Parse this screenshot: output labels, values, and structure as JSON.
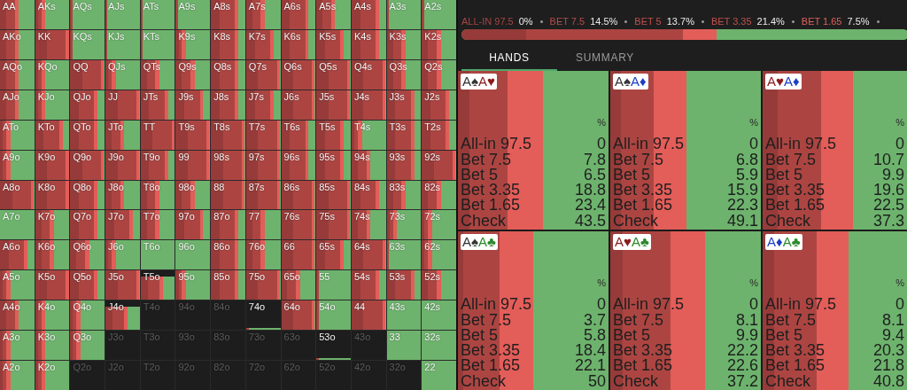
{
  "grid": {
    "rows": [
      {
        "cells": [
          {
            "hand": "AA",
            "kind": "mixed"
          },
          {
            "hand": "AKs",
            "kind": "light"
          },
          {
            "hand": "AQs",
            "kind": "trace"
          },
          {
            "hand": "AJs",
            "kind": "trace"
          },
          {
            "hand": "ATs",
            "kind": "trace"
          },
          {
            "hand": "A9s",
            "kind": "trace"
          },
          {
            "hand": "A8s",
            "kind": "heavy"
          },
          {
            "hand": "A7s",
            "kind": "mixed"
          },
          {
            "hand": "A6s",
            "kind": "heavy"
          },
          {
            "hand": "A5s",
            "kind": "mixed"
          },
          {
            "hand": "A4s",
            "kind": "heavy"
          },
          {
            "hand": "A3s",
            "kind": "trace"
          },
          {
            "hand": "A2s",
            "kind": "trace"
          }
        ]
      },
      {
        "cells": [
          {
            "hand": "AKo",
            "kind": "mixed"
          },
          {
            "hand": "KK",
            "kind": "full"
          },
          {
            "hand": "KQs",
            "kind": "trace"
          },
          {
            "hand": "KJs",
            "kind": "trace"
          },
          {
            "hand": "KTs",
            "kind": "trace"
          },
          {
            "hand": "K9s",
            "kind": "light"
          },
          {
            "hand": "K8s",
            "kind": "heavy"
          },
          {
            "hand": "K7s",
            "kind": "heavy"
          },
          {
            "hand": "K6s",
            "kind": "heavy"
          },
          {
            "hand": "K5s",
            "kind": "heavy"
          },
          {
            "hand": "K4s",
            "kind": "heavy"
          },
          {
            "hand": "K3s",
            "kind": "mixed"
          },
          {
            "hand": "K2s",
            "kind": "mixed"
          }
        ]
      },
      {
        "cells": [
          {
            "hand": "AQo",
            "kind": "mixed"
          },
          {
            "hand": "KQo",
            "kind": "light"
          },
          {
            "hand": "QQ",
            "kind": "full"
          },
          {
            "hand": "QJs",
            "kind": "light"
          },
          {
            "hand": "QTs",
            "kind": "mixed"
          },
          {
            "hand": "Q9s",
            "kind": "mixed"
          },
          {
            "hand": "Q8s",
            "kind": "heavy"
          },
          {
            "hand": "Q7s",
            "kind": "full"
          },
          {
            "hand": "Q6s",
            "kind": "full"
          },
          {
            "hand": "Q5s",
            "kind": "full"
          },
          {
            "hand": "Q4s",
            "kind": "full"
          },
          {
            "hand": "Q3s",
            "kind": "mixed"
          },
          {
            "hand": "Q2s",
            "kind": "mixed"
          }
        ]
      },
      {
        "cells": [
          {
            "hand": "AJo",
            "kind": "mixed"
          },
          {
            "hand": "KJo",
            "kind": "light"
          },
          {
            "hand": "QJo",
            "kind": "heavy"
          },
          {
            "hand": "JJ",
            "kind": "full"
          },
          {
            "hand": "JTs",
            "kind": "heavy"
          },
          {
            "hand": "J9s",
            "kind": "heavy"
          },
          {
            "hand": "J8s",
            "kind": "heavy"
          },
          {
            "hand": "J7s",
            "kind": "heavy"
          },
          {
            "hand": "J6s",
            "kind": "full"
          },
          {
            "hand": "J5s",
            "kind": "full"
          },
          {
            "hand": "J4s",
            "kind": "full"
          },
          {
            "hand": "J3s",
            "kind": "heavy"
          },
          {
            "hand": "J2s",
            "kind": "heavy"
          }
        ]
      },
      {
        "cells": [
          {
            "hand": "ATo",
            "kind": "light"
          },
          {
            "hand": "KTo",
            "kind": "heavy"
          },
          {
            "hand": "QTo",
            "kind": "heavy"
          },
          {
            "hand": "JTo",
            "kind": "mixed"
          },
          {
            "hand": "TT",
            "kind": "full"
          },
          {
            "hand": "T9s",
            "kind": "full"
          },
          {
            "hand": "T8s",
            "kind": "full"
          },
          {
            "hand": "T7s",
            "kind": "full"
          },
          {
            "hand": "T6s",
            "kind": "heavy"
          },
          {
            "hand": "T5s",
            "kind": "heavy"
          },
          {
            "hand": "T4s",
            "kind": "light"
          },
          {
            "hand": "T3s",
            "kind": "heavy"
          },
          {
            "hand": "T2s",
            "kind": "heavy"
          }
        ]
      },
      {
        "cells": [
          {
            "hand": "A9o",
            "kind": "light"
          },
          {
            "hand": "K9o",
            "kind": "full"
          },
          {
            "hand": "Q9o",
            "kind": "full"
          },
          {
            "hand": "J9o",
            "kind": "full"
          },
          {
            "hand": "T9o",
            "kind": "heavy"
          },
          {
            "hand": "99",
            "kind": "full"
          },
          {
            "hand": "98s",
            "kind": "full"
          },
          {
            "hand": "97s",
            "kind": "full"
          },
          {
            "hand": "96s",
            "kind": "heavy"
          },
          {
            "hand": "95s",
            "kind": "heavy"
          },
          {
            "hand": "94s",
            "kind": "mixed"
          },
          {
            "hand": "93s",
            "kind": "heavy"
          },
          {
            "hand": "92s",
            "kind": "full"
          }
        ]
      },
      {
        "cells": [
          {
            "hand": "A8o",
            "kind": "full"
          },
          {
            "hand": "K8o",
            "kind": "full"
          },
          {
            "hand": "Q8o",
            "kind": "heavy"
          },
          {
            "hand": "J8o",
            "kind": "mixed"
          },
          {
            "hand": "T8o",
            "kind": "mixed"
          },
          {
            "hand": "98o",
            "kind": "mixed"
          },
          {
            "hand": "88",
            "kind": "full"
          },
          {
            "hand": "87s",
            "kind": "full"
          },
          {
            "hand": "86s",
            "kind": "full"
          },
          {
            "hand": "85s",
            "kind": "full"
          },
          {
            "hand": "84s",
            "kind": "heavy"
          },
          {
            "hand": "83s",
            "kind": "mixed"
          },
          {
            "hand": "82s",
            "kind": "mixed"
          }
        ]
      },
      {
        "cells": [
          {
            "hand": "A7o",
            "kind": "check"
          },
          {
            "hand": "K7o",
            "kind": "mixed"
          },
          {
            "hand": "Q7o",
            "kind": "heavy"
          },
          {
            "hand": "J7o",
            "kind": "heavy"
          },
          {
            "hand": "T7o",
            "kind": "mixed"
          },
          {
            "hand": "97o",
            "kind": "heavy"
          },
          {
            "hand": "87o",
            "kind": "heavy"
          },
          {
            "hand": "77",
            "kind": "mixed"
          },
          {
            "hand": "76s",
            "kind": "full"
          },
          {
            "hand": "75s",
            "kind": "full"
          },
          {
            "hand": "74s",
            "kind": "mixed"
          },
          {
            "hand": "73s",
            "kind": "light"
          },
          {
            "hand": "72s",
            "kind": "light"
          }
        ]
      },
      {
        "cells": [
          {
            "hand": "A6o",
            "kind": "heavy"
          },
          {
            "hand": "K6o",
            "kind": "mixed"
          },
          {
            "hand": "Q6o",
            "kind": "mixed"
          },
          {
            "hand": "J6o",
            "kind": "light"
          },
          {
            "hand": "T6o",
            "kind": "check"
          },
          {
            "hand": "96o",
            "kind": "check"
          },
          {
            "hand": "86o",
            "kind": "heavy"
          },
          {
            "hand": "76o",
            "kind": "mixed"
          },
          {
            "hand": "66",
            "kind": "full"
          },
          {
            "hand": "65s",
            "kind": "heavy"
          },
          {
            "hand": "64s",
            "kind": "full"
          },
          {
            "hand": "63s",
            "kind": "trace"
          },
          {
            "hand": "62s",
            "kind": "light"
          }
        ]
      },
      {
        "cells": [
          {
            "hand": "A5o",
            "kind": "light"
          },
          {
            "hand": "K5o",
            "kind": "full"
          },
          {
            "hand": "Q5o",
            "kind": "heavy"
          },
          {
            "hand": "J5o",
            "kind": "full"
          },
          {
            "hand": "T5o",
            "kind": "partial"
          },
          {
            "hand": "95o",
            "kind": "light"
          },
          {
            "hand": "85o",
            "kind": "heavy"
          },
          {
            "hand": "75o",
            "kind": "full"
          },
          {
            "hand": "65o",
            "kind": "mixed"
          },
          {
            "hand": "55",
            "kind": "trace"
          },
          {
            "hand": "54s",
            "kind": "heavy"
          },
          {
            "hand": "53s",
            "kind": "heavy"
          },
          {
            "hand": "52s",
            "kind": "mixed"
          }
        ]
      },
      {
        "cells": [
          {
            "hand": "A4o",
            "kind": "mixed"
          },
          {
            "hand": "K4o",
            "kind": "light"
          },
          {
            "hand": "Q4o",
            "kind": "light"
          },
          {
            "hand": "J4o",
            "kind": "partial"
          },
          {
            "hand": "T4o",
            "kind": "empty"
          },
          {
            "hand": "94o",
            "kind": "empty"
          },
          {
            "hand": "84o",
            "kind": "empty"
          },
          {
            "hand": "74o",
            "kind": "sliver"
          },
          {
            "hand": "64o",
            "kind": "full"
          },
          {
            "hand": "54o",
            "kind": "trace"
          },
          {
            "hand": "44",
            "kind": "full"
          },
          {
            "hand": "43s",
            "kind": "check"
          },
          {
            "hand": "42s",
            "kind": "check"
          }
        ]
      },
      {
        "cells": [
          {
            "hand": "A3o",
            "kind": "light"
          },
          {
            "hand": "K3o",
            "kind": "light"
          },
          {
            "hand": "Q3o",
            "kind": "light"
          },
          {
            "hand": "J3o",
            "kind": "empty"
          },
          {
            "hand": "T3o",
            "kind": "empty"
          },
          {
            "hand": "93o",
            "kind": "empty"
          },
          {
            "hand": "83o",
            "kind": "empty"
          },
          {
            "hand": "73o",
            "kind": "empty"
          },
          {
            "hand": "63o",
            "kind": "empty"
          },
          {
            "hand": "53o",
            "kind": "sliver"
          },
          {
            "hand": "43o",
            "kind": "empty"
          },
          {
            "hand": "33",
            "kind": "check"
          },
          {
            "hand": "32s",
            "kind": "check"
          }
        ]
      },
      {
        "cells": [
          {
            "hand": "A2o",
            "kind": "light"
          },
          {
            "hand": "K2o",
            "kind": "light"
          },
          {
            "hand": "Q2o",
            "kind": "empty"
          },
          {
            "hand": "J2o",
            "kind": "empty"
          },
          {
            "hand": "T2o",
            "kind": "empty"
          },
          {
            "hand": "92o",
            "kind": "empty"
          },
          {
            "hand": "82o",
            "kind": "empty"
          },
          {
            "hand": "72o",
            "kind": "empty"
          },
          {
            "hand": "62o",
            "kind": "empty"
          },
          {
            "hand": "52o",
            "kind": "empty"
          },
          {
            "hand": "42o",
            "kind": "empty"
          },
          {
            "hand": "32o",
            "kind": "empty"
          },
          {
            "hand": "22",
            "kind": "check"
          }
        ]
      }
    ]
  },
  "legend": [
    {
      "label": "ALL-IN 97.5",
      "value": "0%",
      "color": "#a84444"
    },
    {
      "label": "BET 7.5",
      "value": "14.5%",
      "color": "#b84c4a"
    },
    {
      "label": "BET 5",
      "value": "13.7%",
      "color": "#c0504d"
    },
    {
      "label": "BET 3.35",
      "value": "21.4%",
      "color": "#c0504d"
    },
    {
      "label": "BET 1.65",
      "value": "7.5%",
      "color": "#e0605b"
    }
  ],
  "tabs": [
    {
      "label": "HANDS",
      "selected": true
    },
    {
      "label": "SUMMARY",
      "selected": false
    }
  ],
  "hands": [
    {
      "cards": [
        {
          "rank": "A",
          "suit": "♠",
          "color": "#333333"
        },
        {
          "rank": "A",
          "suit": "♥",
          "color": "#8b1a1a"
        }
      ],
      "unit": "%",
      "rows": [
        {
          "label": "All-in 97.5",
          "value": "0"
        },
        {
          "label": "Bet 7.5",
          "value": "7.8"
        },
        {
          "label": "Bet 5",
          "value": "6.5"
        },
        {
          "label": "Bet 3.35",
          "value": "18.8"
        },
        {
          "label": "Bet 1.65",
          "value": "23.4"
        },
        {
          "label": "Check",
          "value": "43.5"
        }
      ]
    },
    {
      "cards": [
        {
          "rank": "A",
          "suit": "♠",
          "color": "#333333"
        },
        {
          "rank": "A",
          "suit": "♦",
          "color": "#1d3fc4"
        }
      ],
      "unit": "%",
      "rows": [
        {
          "label": "All-in 97.5",
          "value": "0"
        },
        {
          "label": "Bet 7.5",
          "value": "6.8"
        },
        {
          "label": "Bet 5",
          "value": "5.9"
        },
        {
          "label": "Bet 3.35",
          "value": "15.9"
        },
        {
          "label": "Bet 1.65",
          "value": "22.3"
        },
        {
          "label": "Check",
          "value": "49.1"
        }
      ]
    },
    {
      "cards": [
        {
          "rank": "A",
          "suit": "♥",
          "color": "#8b1a1a"
        },
        {
          "rank": "A",
          "suit": "♦",
          "color": "#1d3fc4"
        }
      ],
      "unit": "%",
      "rows": [
        {
          "label": "All-in 97.5",
          "value": "0"
        },
        {
          "label": "Bet 7.5",
          "value": "10.7"
        },
        {
          "label": "Bet 5",
          "value": "9.9"
        },
        {
          "label": "Bet 3.35",
          "value": "19.6"
        },
        {
          "label": "Bet 1.65",
          "value": "22.5"
        },
        {
          "label": "Check",
          "value": "37.3"
        }
      ]
    },
    {
      "cards": [
        {
          "rank": "A",
          "suit": "♠",
          "color": "#333333"
        },
        {
          "rank": "A",
          "suit": "♣",
          "color": "#2c8a2c"
        }
      ],
      "unit": "%",
      "rows": [
        {
          "label": "All-in 97.5",
          "value": "0"
        },
        {
          "label": "Bet 7.5",
          "value": "3.7"
        },
        {
          "label": "Bet 5",
          "value": "5.8"
        },
        {
          "label": "Bet 3.35",
          "value": "18.4"
        },
        {
          "label": "Bet 1.65",
          "value": "22.1"
        },
        {
          "label": "Check",
          "value": "50"
        }
      ]
    },
    {
      "cards": [
        {
          "rank": "A",
          "suit": "♥",
          "color": "#8b1a1a"
        },
        {
          "rank": "A",
          "suit": "♣",
          "color": "#2c8a2c"
        }
      ],
      "unit": "%",
      "rows": [
        {
          "label": "All-in 97.5",
          "value": "0"
        },
        {
          "label": "Bet 7.5",
          "value": "8.1"
        },
        {
          "label": "Bet 5",
          "value": "9.9"
        },
        {
          "label": "Bet 3.35",
          "value": "22.2"
        },
        {
          "label": "Bet 1.65",
          "value": "22.6"
        },
        {
          "label": "Check",
          "value": "37.2"
        }
      ]
    },
    {
      "cards": [
        {
          "rank": "A",
          "suit": "♦",
          "color": "#1d3fc4"
        },
        {
          "rank": "A",
          "suit": "♣",
          "color": "#2c8a2c"
        }
      ],
      "unit": "%",
      "rows": [
        {
          "label": "All-in 97.5",
          "value": "0"
        },
        {
          "label": "Bet 7.5",
          "value": "8.1"
        },
        {
          "label": "Bet 5",
          "value": "9.4"
        },
        {
          "label": "Bet 3.35",
          "value": "20.3"
        },
        {
          "label": "Bet 1.65",
          "value": "21.8"
        },
        {
          "label": "Check",
          "value": "40.8"
        }
      ]
    }
  ]
}
